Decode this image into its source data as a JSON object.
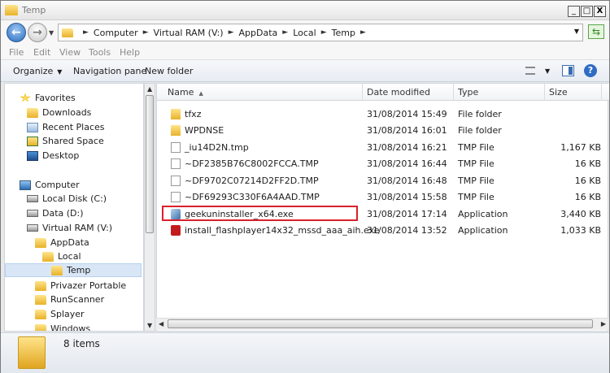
{
  "window": {
    "title": "Temp"
  },
  "window_buttons": {
    "minimize": "_",
    "maximize": "□",
    "close": "X"
  },
  "address": {
    "crumbs": [
      "Computer",
      "Virtual RAM (V:)",
      "AppData",
      "Local",
      "Temp"
    ]
  },
  "menu": {
    "file": "File",
    "edit": "Edit",
    "view": "View",
    "tools": "Tools",
    "help": "Help"
  },
  "toolbar": {
    "organize": "Organize",
    "navigation_pane": "Navigation pane",
    "new_folder": "New folder"
  },
  "nav_pane": {
    "favorites": "Favorites",
    "downloads": "Downloads",
    "recent_places": "Recent Places",
    "shared_space": "Shared Space",
    "desktop": "Desktop",
    "computer": "Computer",
    "local_disk": "Local Disk (C:)",
    "data_drive": "Data (D:)",
    "virtual_ram": "Virtual RAM (V:)",
    "appdata": "AppData",
    "local": "Local",
    "temp": "Temp",
    "privazer": "Privazer Portable",
    "runscanner": "RunScanner",
    "splayer": "Splayer",
    "windows": "Windows"
  },
  "columns": {
    "name": "Name",
    "date": "Date modified",
    "type": "Type",
    "size": "Size"
  },
  "files": [
    {
      "name": "tfxz",
      "date": "31/08/2014 15:49",
      "type": "File folder",
      "size": ""
    },
    {
      "name": "WPDNSE",
      "date": "31/08/2014 16:01",
      "type": "File folder",
      "size": ""
    },
    {
      "name": "_iu14D2N.tmp",
      "date": "31/08/2014 16:21",
      "type": "TMP File",
      "size": "1,167 KB"
    },
    {
      "name": "~DF2385B76C8002FCCA.TMP",
      "date": "31/08/2014 16:44",
      "type": "TMP File",
      "size": "16 KB"
    },
    {
      "name": "~DF9702C07214D2FF2D.TMP",
      "date": "31/08/2014 16:48",
      "type": "TMP File",
      "size": "16 KB"
    },
    {
      "name": "~DF69293C330F6A4AAD.TMP",
      "date": "31/08/2014 15:58",
      "type": "TMP File",
      "size": "16 KB"
    },
    {
      "name": "geekuninstaller_x64.exe",
      "date": "31/08/2014 17:14",
      "type": "Application",
      "size": "3,440 KB"
    },
    {
      "name": "install_flashplayer14x32_mssd_aaa_aih.exe",
      "date": "31/08/2014 13:52",
      "type": "Application",
      "size": "1,033 KB"
    }
  ],
  "status": {
    "count": "8 items"
  }
}
